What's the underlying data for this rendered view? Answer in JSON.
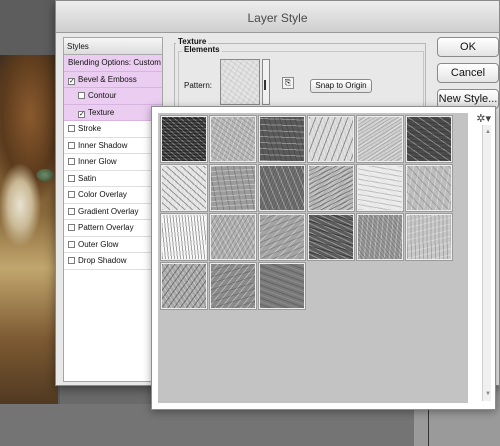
{
  "dialog": {
    "title": "Layer Style",
    "buttons": {
      "ok": "OK",
      "cancel": "Cancel",
      "new_style": "New Style..."
    }
  },
  "styles_panel": {
    "header": "Styles",
    "blending_options": "Blending Options: Custom",
    "items": [
      {
        "label": "Bevel & Emboss",
        "checked": true,
        "highlighted": true,
        "indent": false
      },
      {
        "label": "Contour",
        "checked": false,
        "highlighted": true,
        "indent": true
      },
      {
        "label": "Texture",
        "checked": true,
        "highlighted": true,
        "indent": true
      },
      {
        "label": "Stroke",
        "checked": false,
        "highlighted": false,
        "indent": false
      },
      {
        "label": "Inner Shadow",
        "checked": false,
        "highlighted": false,
        "indent": false
      },
      {
        "label": "Inner Glow",
        "checked": false,
        "highlighted": false,
        "indent": false
      },
      {
        "label": "Satin",
        "checked": false,
        "highlighted": false,
        "indent": false
      },
      {
        "label": "Color Overlay",
        "checked": false,
        "highlighted": false,
        "indent": false
      },
      {
        "label": "Gradient Overlay",
        "checked": false,
        "highlighted": false,
        "indent": false
      },
      {
        "label": "Pattern Overlay",
        "checked": false,
        "highlighted": false,
        "indent": false
      },
      {
        "label": "Outer Glow",
        "checked": false,
        "highlighted": false,
        "indent": false
      },
      {
        "label": "Drop Shadow",
        "checked": false,
        "highlighted": false,
        "indent": false
      }
    ]
  },
  "texture": {
    "group_title": "Texture",
    "elements_title": "Elements",
    "pattern_label": "Pattern:",
    "new_preset_icon": "new-preset-icon",
    "snap_button": "Snap to Origin"
  },
  "picker": {
    "menu_icon": "gear-icon",
    "pattern_count": 21,
    "tile_tones": [
      "#3d3d3d",
      "#b8b8b8",
      "#5a5a5a",
      "#d8d8d8",
      "#cfcfcf",
      "#4a4a4a",
      "#e2e2e2",
      "#9c9c9c",
      "#707070",
      "#b5b5b5",
      "#e9e9e9",
      "#bdbdbd",
      "#f7f7f7",
      "#b0b0b0",
      "#a3a3a3",
      "#5c5c5c",
      "#999999",
      "#c8c8c8",
      "#a8a8a8",
      "#8a8a8a",
      "#7a7a7a"
    ]
  }
}
